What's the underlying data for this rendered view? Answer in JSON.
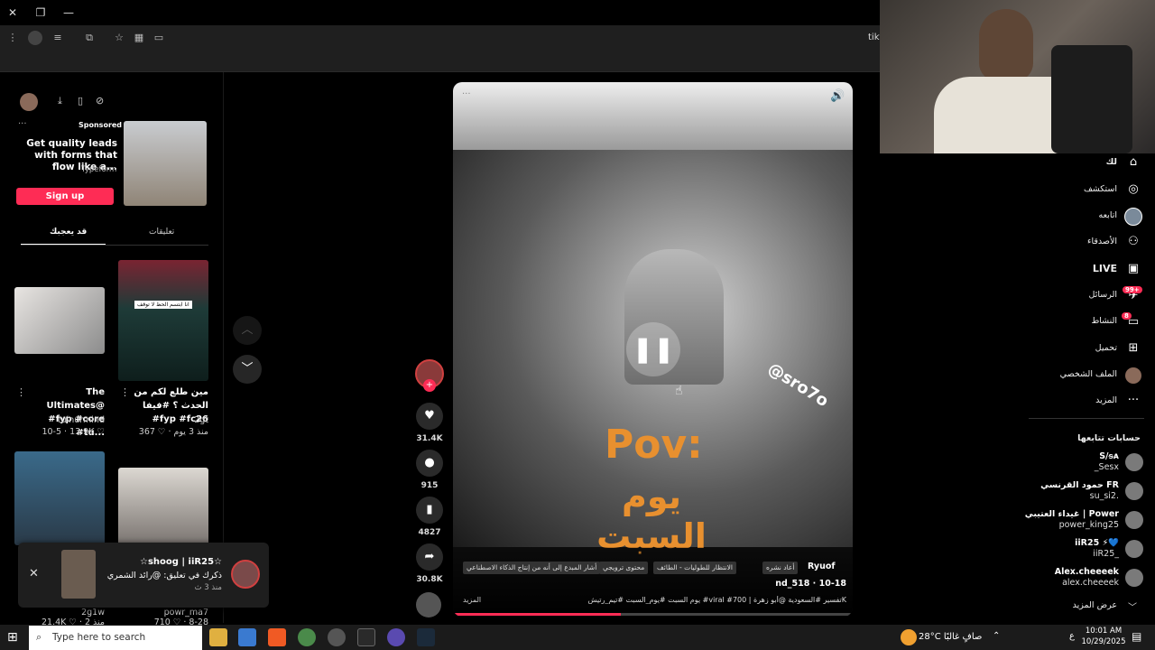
{
  "browser": {
    "tab_label": "tikt",
    "win_close": "✕",
    "win_restore": "❐",
    "win_min": "—"
  },
  "left": {
    "ad": {
      "sponsored": "Sponsored",
      "title": "Get quality leads with forms that flow like a...",
      "brand": "Typeform",
      "signup": "Sign up"
    },
    "tabs": [
      "قد يعجبك",
      "تعليقات"
    ],
    "videos": [
      {
        "caption": "The Ultimates@ #fyp #core #tu...",
        "author": "tuinurmind",
        "stats": "10-5 · 13.9K ♡"
      },
      {
        "caption": "مين طلع لكم من الحدث ؟ #فيفا #fyp #fc26",
        "author": "2gt",
        "stats": "367 ♡ · منذ 3 يوم",
        "overlay": "انا ابتسم الحظ لا توقف"
      },
      {
        "caption": "",
        "author": "2g1w",
        "stats": "21.4K ♡ · منذ 2 يوم"
      },
      {
        "caption": "",
        "author": "powr_ma7",
        "stats": "710 ♡ · 8-28"
      }
    ]
  },
  "notification": {
    "title": "☆shoog | iiR25☆",
    "body": "ذكرك في تعليق: @رائد الشمري",
    "time": "منذ 3 ث"
  },
  "player": {
    "watermark": "@sro7o",
    "pov": "Pov:",
    "arabic_title": "يوم السبت",
    "author_handle": "nd_518 · 10-18",
    "author_name": "Ryuof",
    "tags": [
      "أعاد نشره",
      "الانتظار للطوليات - الطائف",
      "محتوى ترويجي",
      "أشار المبدع إلى أنه من إنتاج الذكاء الاصطناعي"
    ],
    "desc": "يوم السبت #يوم_السبت #تيم_رتيش #viral #تفسير #السعودية @أبو زهرة | 700K",
    "more": "المزيد"
  },
  "actions": {
    "likes": "31.4K",
    "comments": "915",
    "saves": "4827",
    "shares": "30.8K"
  },
  "nav": {
    "items": [
      "لك",
      "استكشف",
      "اتابعه",
      "الأصدقاء",
      "LIVE",
      "الرسائل",
      "النشاط",
      "تحميل",
      "الملف الشخصي",
      "المزيد"
    ],
    "msg_badge": "99+",
    "activity_badge": "8",
    "following_title": "حسابات تتابعها",
    "following": [
      {
        "name": "S/ᵴᴀ",
        "handle": "_Sesx"
      },
      {
        "name": "حمود القرنسي FR",
        "handle": "su_si2."
      },
      {
        "name": "غيداء العتيبي | Power",
        "handle": "power_king25"
      },
      {
        "name": "iiR25 ⚡💙",
        "handle": "iiR25_"
      },
      {
        "name": "Alex.cheeeek",
        "handle": "alex.cheeeek"
      }
    ],
    "see_more": "عرض المزيد"
  },
  "taskbar": {
    "search": "Type here to search",
    "weather": "28°C صافٍ غالبًا",
    "lang": "ع",
    "time": "10:01 AM",
    "date": "10/29/2025"
  },
  "colors": {
    "accent": "#fe2c55",
    "pov": "#e8902f"
  }
}
